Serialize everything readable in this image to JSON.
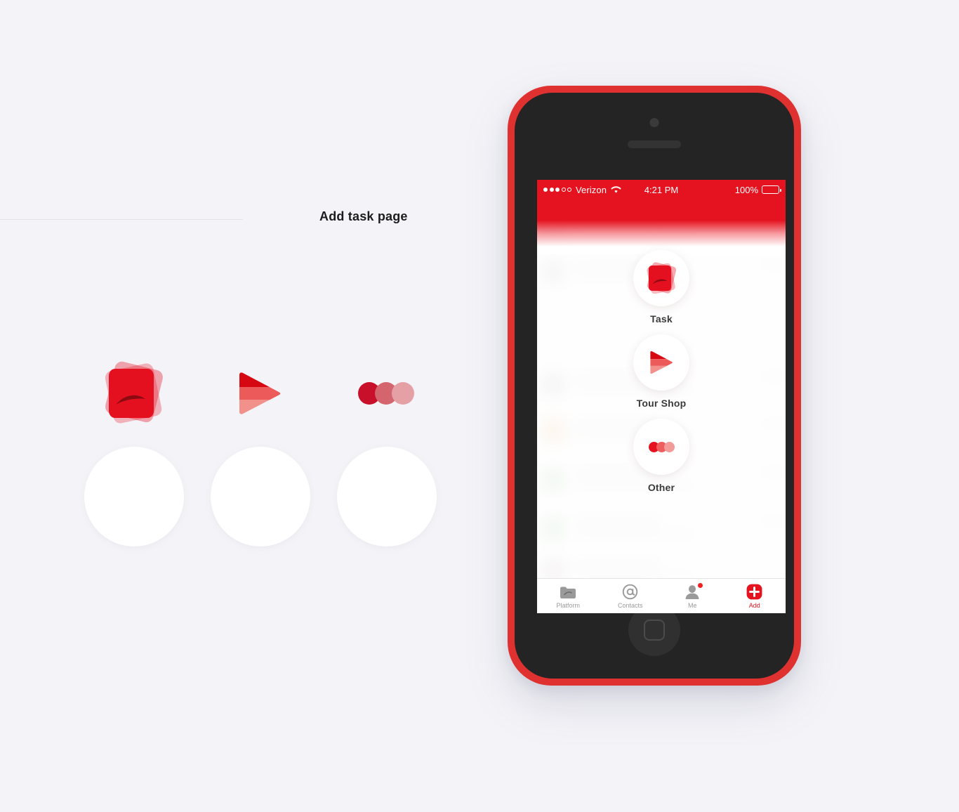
{
  "page": {
    "title": "Add task page",
    "background_color": "#f4f4f8",
    "accent_color": "#e4131f"
  },
  "icon_samples": [
    {
      "name": "task-stacked-cards-icon",
      "colors": [
        "#e4101f",
        "#e8192c"
      ]
    },
    {
      "name": "tour-shop-arrow-icon",
      "colors": [
        "#d60812",
        "#ec5a5a",
        "#f2908c"
      ]
    },
    {
      "name": "other-dots-icon",
      "colors": [
        "#c8102a",
        "#d4646e",
        "#e5a0a6"
      ]
    }
  ],
  "blank_circles": [
    {
      "name": "circle-placeholder-1"
    },
    {
      "name": "circle-placeholder-2"
    },
    {
      "name": "circle-placeholder-3"
    }
  ],
  "phone": {
    "frame_color": "#e03131",
    "body_color": "#242424",
    "status_bar": {
      "carrier": "Verizon",
      "signal_dots_filled": 3,
      "signal_dots_total": 5,
      "wifi": "wifi-icon",
      "time": "4:21 PM",
      "battery_percent": "100%"
    },
    "menu": {
      "items": [
        {
          "label": "Task",
          "icon": "task-stacked-cards-icon"
        },
        {
          "label": "Tour Shop",
          "icon": "arrow-play-icon"
        },
        {
          "label": "Other",
          "icon": "three-dots-icon"
        }
      ]
    },
    "tab_bar": {
      "tabs": [
        {
          "label": "Platform",
          "icon": "folder-icon",
          "active": false,
          "badge": false
        },
        {
          "label": "Contacts",
          "icon": "at-sign-icon",
          "active": false,
          "badge": false
        },
        {
          "label": "Me",
          "icon": "person-icon",
          "active": false,
          "badge": true
        },
        {
          "label": "Add",
          "icon": "plus-square-icon",
          "active": true,
          "badge": false
        }
      ]
    },
    "background_rows": [
      {
        "tint": "#c9c9c9"
      },
      {
        "tint": "#f0c9a0"
      },
      {
        "tint": "#bcd9bc"
      },
      {
        "tint": "#bcd9bc"
      },
      {
        "tint": "#d3c6c6"
      }
    ]
  }
}
